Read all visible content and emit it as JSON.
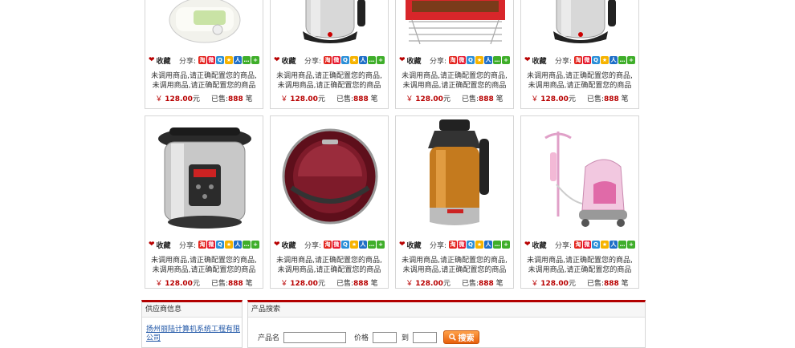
{
  "product_grid": {
    "fav_label": "收藏",
    "share_label": "分享:",
    "share_icons": [
      {
        "name": "taobao-icon",
        "color": "#e3261e",
        "glyph": "淘"
      },
      {
        "name": "weibo-icon",
        "color": "#e6162d",
        "glyph": "微"
      },
      {
        "name": "qzone-icon",
        "color": "#2b8fd8",
        "glyph": "Q"
      },
      {
        "name": "star-icon",
        "color": "#f6b300",
        "glyph": "★"
      },
      {
        "name": "people-icon",
        "color": "#1f6fc7",
        "glyph": "人"
      },
      {
        "name": "chat-icon",
        "color": "#3fae2a",
        "glyph": "…"
      },
      {
        "name": "plus-icon",
        "color": "#3fae2a",
        "glyph": "+"
      }
    ],
    "rows": [
      [
        {
          "title": "未调用商品,请正确配置您的商品,未调用商品,请正确配置您的商品",
          "yen": "￥",
          "price": "128.00",
          "unit": "元",
          "sold_label": "已售:",
          "sold": "888",
          "sold_unit": "笔",
          "image": "rice-cooker"
        },
        {
          "title": "未调用商品,请正确配置您的商品,未调用商品,请正确配置您的商品",
          "yen": "￥",
          "price": "128.00",
          "unit": "元",
          "sold_label": "已售:",
          "sold": "888",
          "sold_unit": "笔",
          "image": "kettle"
        },
        {
          "title": "未调用商品,请正确配置您的商品,未调用商品,请正确配置您的商品",
          "yen": "￥",
          "price": "128.00",
          "unit": "元",
          "sold_label": "已售:",
          "sold": "888",
          "sold_unit": "笔",
          "image": "grill"
        },
        {
          "title": "未调用商品,请正确配置您的商品,未调用商品,请正确配置您的商品",
          "yen": "￥",
          "price": "128.00",
          "unit": "元",
          "sold_label": "已售:",
          "sold": "888",
          "sold_unit": "笔",
          "image": "kettle"
        }
      ],
      [
        {
          "title": "未调用商品,请正确配置您的商品,未调用商品,请正确配置您的商品",
          "yen": "￥",
          "price": "128.00",
          "unit": "元",
          "sold_label": "已售:",
          "sold": "888",
          "sold_unit": "笔",
          "image": "pressure-cooker"
        },
        {
          "title": "未调用商品,请正确配置您的商品,未调用商品,请正确配置您的商品",
          "yen": "￥",
          "price": "128.00",
          "unit": "元",
          "sold_label": "已售:",
          "sold": "888",
          "sold_unit": "笔",
          "image": "robot-vacuum"
        },
        {
          "title": "未调用商品,请正确配置您的商品,未调用商品,请正确配置您的商品",
          "yen": "￥",
          "price": "128.00",
          "unit": "元",
          "sold_label": "已售:",
          "sold": "888",
          "sold_unit": "笔",
          "image": "thermos-jug"
        },
        {
          "title": "未调用商品,请正确配置您的商品,未调用商品,请正确配置您的商品",
          "yen": "￥",
          "price": "128.00",
          "unit": "元",
          "sold_label": "已售:",
          "sold": "888",
          "sold_unit": "笔",
          "image": "garment-steamer"
        }
      ]
    ]
  },
  "supplier_panel": {
    "title": "供应商信息",
    "company": "扬州丽陆计算机系统工程有限公司"
  },
  "search_panel": {
    "title": "产品搜索",
    "name_label": "产品名",
    "price_label": "价格",
    "to_label": "到",
    "button_label": "搜索",
    "name_value": "",
    "min_value": "",
    "max_value": ""
  },
  "colors": {
    "accent": "#b20000",
    "price": "#b80000",
    "link": "#1e55a6",
    "button": "#f07a1e"
  }
}
